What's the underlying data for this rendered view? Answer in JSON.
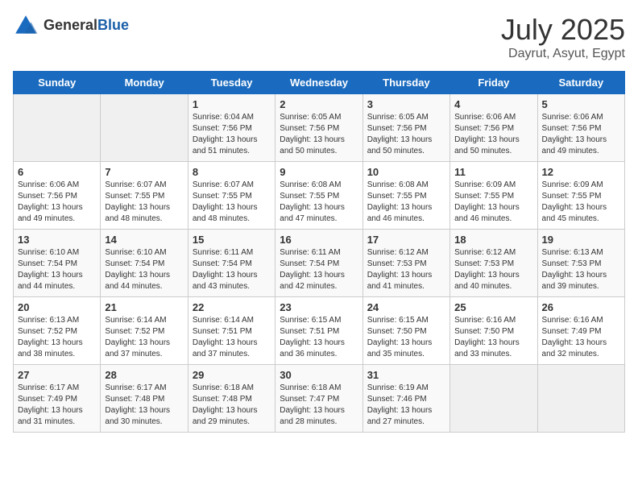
{
  "header": {
    "logo_general": "General",
    "logo_blue": "Blue",
    "month": "July 2025",
    "location": "Dayrut, Asyut, Egypt"
  },
  "weekdays": [
    "Sunday",
    "Monday",
    "Tuesday",
    "Wednesday",
    "Thursday",
    "Friday",
    "Saturday"
  ],
  "weeks": [
    [
      {
        "day": "",
        "info": ""
      },
      {
        "day": "",
        "info": ""
      },
      {
        "day": "1",
        "info": "Sunrise: 6:04 AM\nSunset: 7:56 PM\nDaylight: 13 hours\nand 51 minutes."
      },
      {
        "day": "2",
        "info": "Sunrise: 6:05 AM\nSunset: 7:56 PM\nDaylight: 13 hours\nand 50 minutes."
      },
      {
        "day": "3",
        "info": "Sunrise: 6:05 AM\nSunset: 7:56 PM\nDaylight: 13 hours\nand 50 minutes."
      },
      {
        "day": "4",
        "info": "Sunrise: 6:06 AM\nSunset: 7:56 PM\nDaylight: 13 hours\nand 50 minutes."
      },
      {
        "day": "5",
        "info": "Sunrise: 6:06 AM\nSunset: 7:56 PM\nDaylight: 13 hours\nand 49 minutes."
      }
    ],
    [
      {
        "day": "6",
        "info": "Sunrise: 6:06 AM\nSunset: 7:56 PM\nDaylight: 13 hours\nand 49 minutes."
      },
      {
        "day": "7",
        "info": "Sunrise: 6:07 AM\nSunset: 7:55 PM\nDaylight: 13 hours\nand 48 minutes."
      },
      {
        "day": "8",
        "info": "Sunrise: 6:07 AM\nSunset: 7:55 PM\nDaylight: 13 hours\nand 48 minutes."
      },
      {
        "day": "9",
        "info": "Sunrise: 6:08 AM\nSunset: 7:55 PM\nDaylight: 13 hours\nand 47 minutes."
      },
      {
        "day": "10",
        "info": "Sunrise: 6:08 AM\nSunset: 7:55 PM\nDaylight: 13 hours\nand 46 minutes."
      },
      {
        "day": "11",
        "info": "Sunrise: 6:09 AM\nSunset: 7:55 PM\nDaylight: 13 hours\nand 46 minutes."
      },
      {
        "day": "12",
        "info": "Sunrise: 6:09 AM\nSunset: 7:55 PM\nDaylight: 13 hours\nand 45 minutes."
      }
    ],
    [
      {
        "day": "13",
        "info": "Sunrise: 6:10 AM\nSunset: 7:54 PM\nDaylight: 13 hours\nand 44 minutes."
      },
      {
        "day": "14",
        "info": "Sunrise: 6:10 AM\nSunset: 7:54 PM\nDaylight: 13 hours\nand 44 minutes."
      },
      {
        "day": "15",
        "info": "Sunrise: 6:11 AM\nSunset: 7:54 PM\nDaylight: 13 hours\nand 43 minutes."
      },
      {
        "day": "16",
        "info": "Sunrise: 6:11 AM\nSunset: 7:54 PM\nDaylight: 13 hours\nand 42 minutes."
      },
      {
        "day": "17",
        "info": "Sunrise: 6:12 AM\nSunset: 7:53 PM\nDaylight: 13 hours\nand 41 minutes."
      },
      {
        "day": "18",
        "info": "Sunrise: 6:12 AM\nSunset: 7:53 PM\nDaylight: 13 hours\nand 40 minutes."
      },
      {
        "day": "19",
        "info": "Sunrise: 6:13 AM\nSunset: 7:53 PM\nDaylight: 13 hours\nand 39 minutes."
      }
    ],
    [
      {
        "day": "20",
        "info": "Sunrise: 6:13 AM\nSunset: 7:52 PM\nDaylight: 13 hours\nand 38 minutes."
      },
      {
        "day": "21",
        "info": "Sunrise: 6:14 AM\nSunset: 7:52 PM\nDaylight: 13 hours\nand 37 minutes."
      },
      {
        "day": "22",
        "info": "Sunrise: 6:14 AM\nSunset: 7:51 PM\nDaylight: 13 hours\nand 37 minutes."
      },
      {
        "day": "23",
        "info": "Sunrise: 6:15 AM\nSunset: 7:51 PM\nDaylight: 13 hours\nand 36 minutes."
      },
      {
        "day": "24",
        "info": "Sunrise: 6:15 AM\nSunset: 7:50 PM\nDaylight: 13 hours\nand 35 minutes."
      },
      {
        "day": "25",
        "info": "Sunrise: 6:16 AM\nSunset: 7:50 PM\nDaylight: 13 hours\nand 33 minutes."
      },
      {
        "day": "26",
        "info": "Sunrise: 6:16 AM\nSunset: 7:49 PM\nDaylight: 13 hours\nand 32 minutes."
      }
    ],
    [
      {
        "day": "27",
        "info": "Sunrise: 6:17 AM\nSunset: 7:49 PM\nDaylight: 13 hours\nand 31 minutes."
      },
      {
        "day": "28",
        "info": "Sunrise: 6:17 AM\nSunset: 7:48 PM\nDaylight: 13 hours\nand 30 minutes."
      },
      {
        "day": "29",
        "info": "Sunrise: 6:18 AM\nSunset: 7:48 PM\nDaylight: 13 hours\nand 29 minutes."
      },
      {
        "day": "30",
        "info": "Sunrise: 6:18 AM\nSunset: 7:47 PM\nDaylight: 13 hours\nand 28 minutes."
      },
      {
        "day": "31",
        "info": "Sunrise: 6:19 AM\nSunset: 7:46 PM\nDaylight: 13 hours\nand 27 minutes."
      },
      {
        "day": "",
        "info": ""
      },
      {
        "day": "",
        "info": ""
      }
    ]
  ]
}
